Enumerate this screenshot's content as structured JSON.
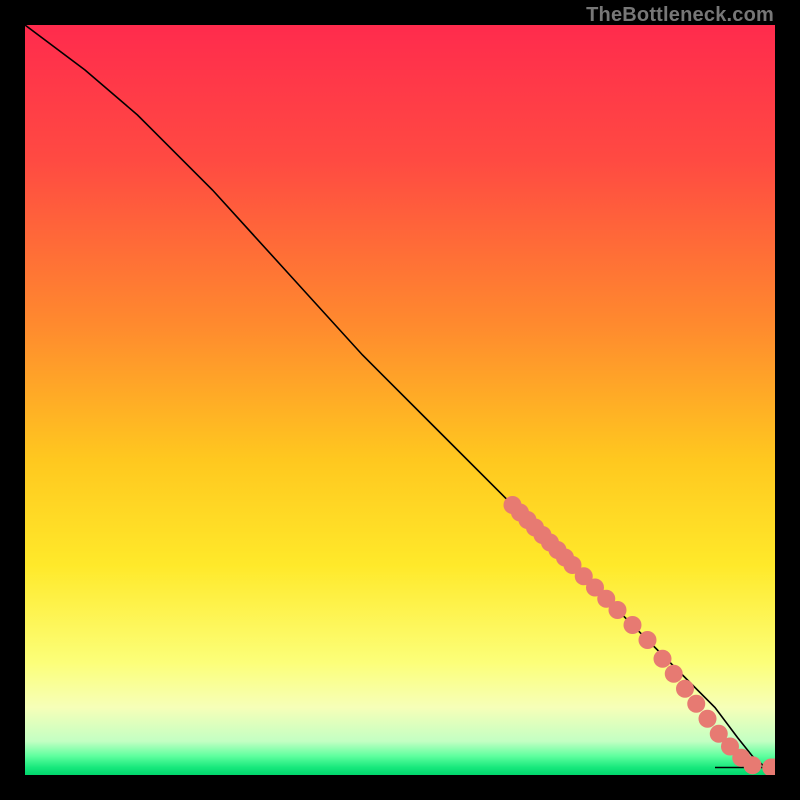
{
  "watermark": {
    "text": "TheBottleneck.com"
  },
  "chart_data": {
    "type": "line",
    "title": "",
    "xlabel": "",
    "ylabel": "",
    "xlim": [
      0,
      100
    ],
    "ylim": [
      0,
      100
    ],
    "gradient_stops": [
      {
        "offset": 0.0,
        "color": "#ff2b4d"
      },
      {
        "offset": 0.18,
        "color": "#ff4a42"
      },
      {
        "offset": 0.4,
        "color": "#ff8a2e"
      },
      {
        "offset": 0.58,
        "color": "#ffc81f"
      },
      {
        "offset": 0.72,
        "color": "#ffe92a"
      },
      {
        "offset": 0.85,
        "color": "#fcff79"
      },
      {
        "offset": 0.91,
        "color": "#f6ffb8"
      },
      {
        "offset": 0.955,
        "color": "#c3ffc3"
      },
      {
        "offset": 0.975,
        "color": "#5dff9e"
      },
      {
        "offset": 0.99,
        "color": "#17e87c"
      },
      {
        "offset": 1.0,
        "color": "#00d66c"
      }
    ],
    "curve": {
      "x": [
        0,
        8,
        15,
        25,
        35,
        45,
        55,
        65,
        72,
        78,
        83,
        88,
        92,
        95,
        97,
        98.5,
        100
      ],
      "y": [
        100,
        94,
        88,
        78,
        67,
        56,
        46,
        36,
        29,
        23,
        18,
        13,
        9,
        5,
        2.5,
        1.2,
        1.0
      ]
    },
    "flat_tail": {
      "x": [
        92,
        100
      ],
      "y": [
        1.0,
        1.0
      ]
    },
    "markers": {
      "color": "#e77a72",
      "radius": 1.2,
      "points": [
        {
          "x": 65,
          "y": 36
        },
        {
          "x": 66,
          "y": 35
        },
        {
          "x": 67,
          "y": 34
        },
        {
          "x": 68,
          "y": 33
        },
        {
          "x": 69,
          "y": 32
        },
        {
          "x": 70,
          "y": 31
        },
        {
          "x": 71,
          "y": 30
        },
        {
          "x": 72,
          "y": 29
        },
        {
          "x": 73,
          "y": 28
        },
        {
          "x": 74.5,
          "y": 26.5
        },
        {
          "x": 76,
          "y": 25
        },
        {
          "x": 77.5,
          "y": 23.5
        },
        {
          "x": 79,
          "y": 22
        },
        {
          "x": 81,
          "y": 20
        },
        {
          "x": 83,
          "y": 18
        },
        {
          "x": 85,
          "y": 15.5
        },
        {
          "x": 86.5,
          "y": 13.5
        },
        {
          "x": 88,
          "y": 11.5
        },
        {
          "x": 89.5,
          "y": 9.5
        },
        {
          "x": 91,
          "y": 7.5
        },
        {
          "x": 92.5,
          "y": 5.5
        },
        {
          "x": 94,
          "y": 3.8
        },
        {
          "x": 95.5,
          "y": 2.3
        },
        {
          "x": 97,
          "y": 1.3
        },
        {
          "x": 99.5,
          "y": 1.0
        },
        {
          "x": 100,
          "y": 1.0
        }
      ]
    }
  }
}
